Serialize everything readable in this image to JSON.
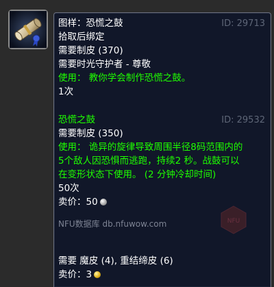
{
  "item1": {
    "name": "图样：恐慌之鼓",
    "id": "ID: 29713",
    "binding": "拾取后绑定",
    "req_skill": "需要制皮 (370)",
    "req_rep": "需要时光守护者 - 尊敬",
    "use": "使用： 教你学会制作恐慌之鼓。",
    "charges": "1次"
  },
  "item2": {
    "name": "恐慌之鼓",
    "id": "ID: 29532",
    "req_skill": "需要制皮 (350)",
    "use_line1": "使用： 诡异的旋律导致周围半径8码范围内的",
    "use_line2": "5个敌人因恐惧而逃跑，持续2 秒。战鼓可以",
    "use_line3": "在变形状态下使用。 (2 分钟冷却时间)",
    "charges": "50次",
    "sell_label": "卖价：50",
    "source": "NFU数据库 db.nfuwow.com"
  },
  "reagents": {
    "text": "需要 魔皮 (4), 重结缔皮 (6)",
    "sell_label": "卖价：3"
  },
  "watermark_text": "NFU",
  "colors": {
    "name_white": "#ffffff",
    "use_green": "#1eff00",
    "id_gray": "#5e6677",
    "tooltip_bg": "#111729"
  },
  "icons": {
    "item_icon": "scroll-pattern-icon",
    "silver": "silver-coin-icon",
    "gold": "gold-coin-icon"
  }
}
